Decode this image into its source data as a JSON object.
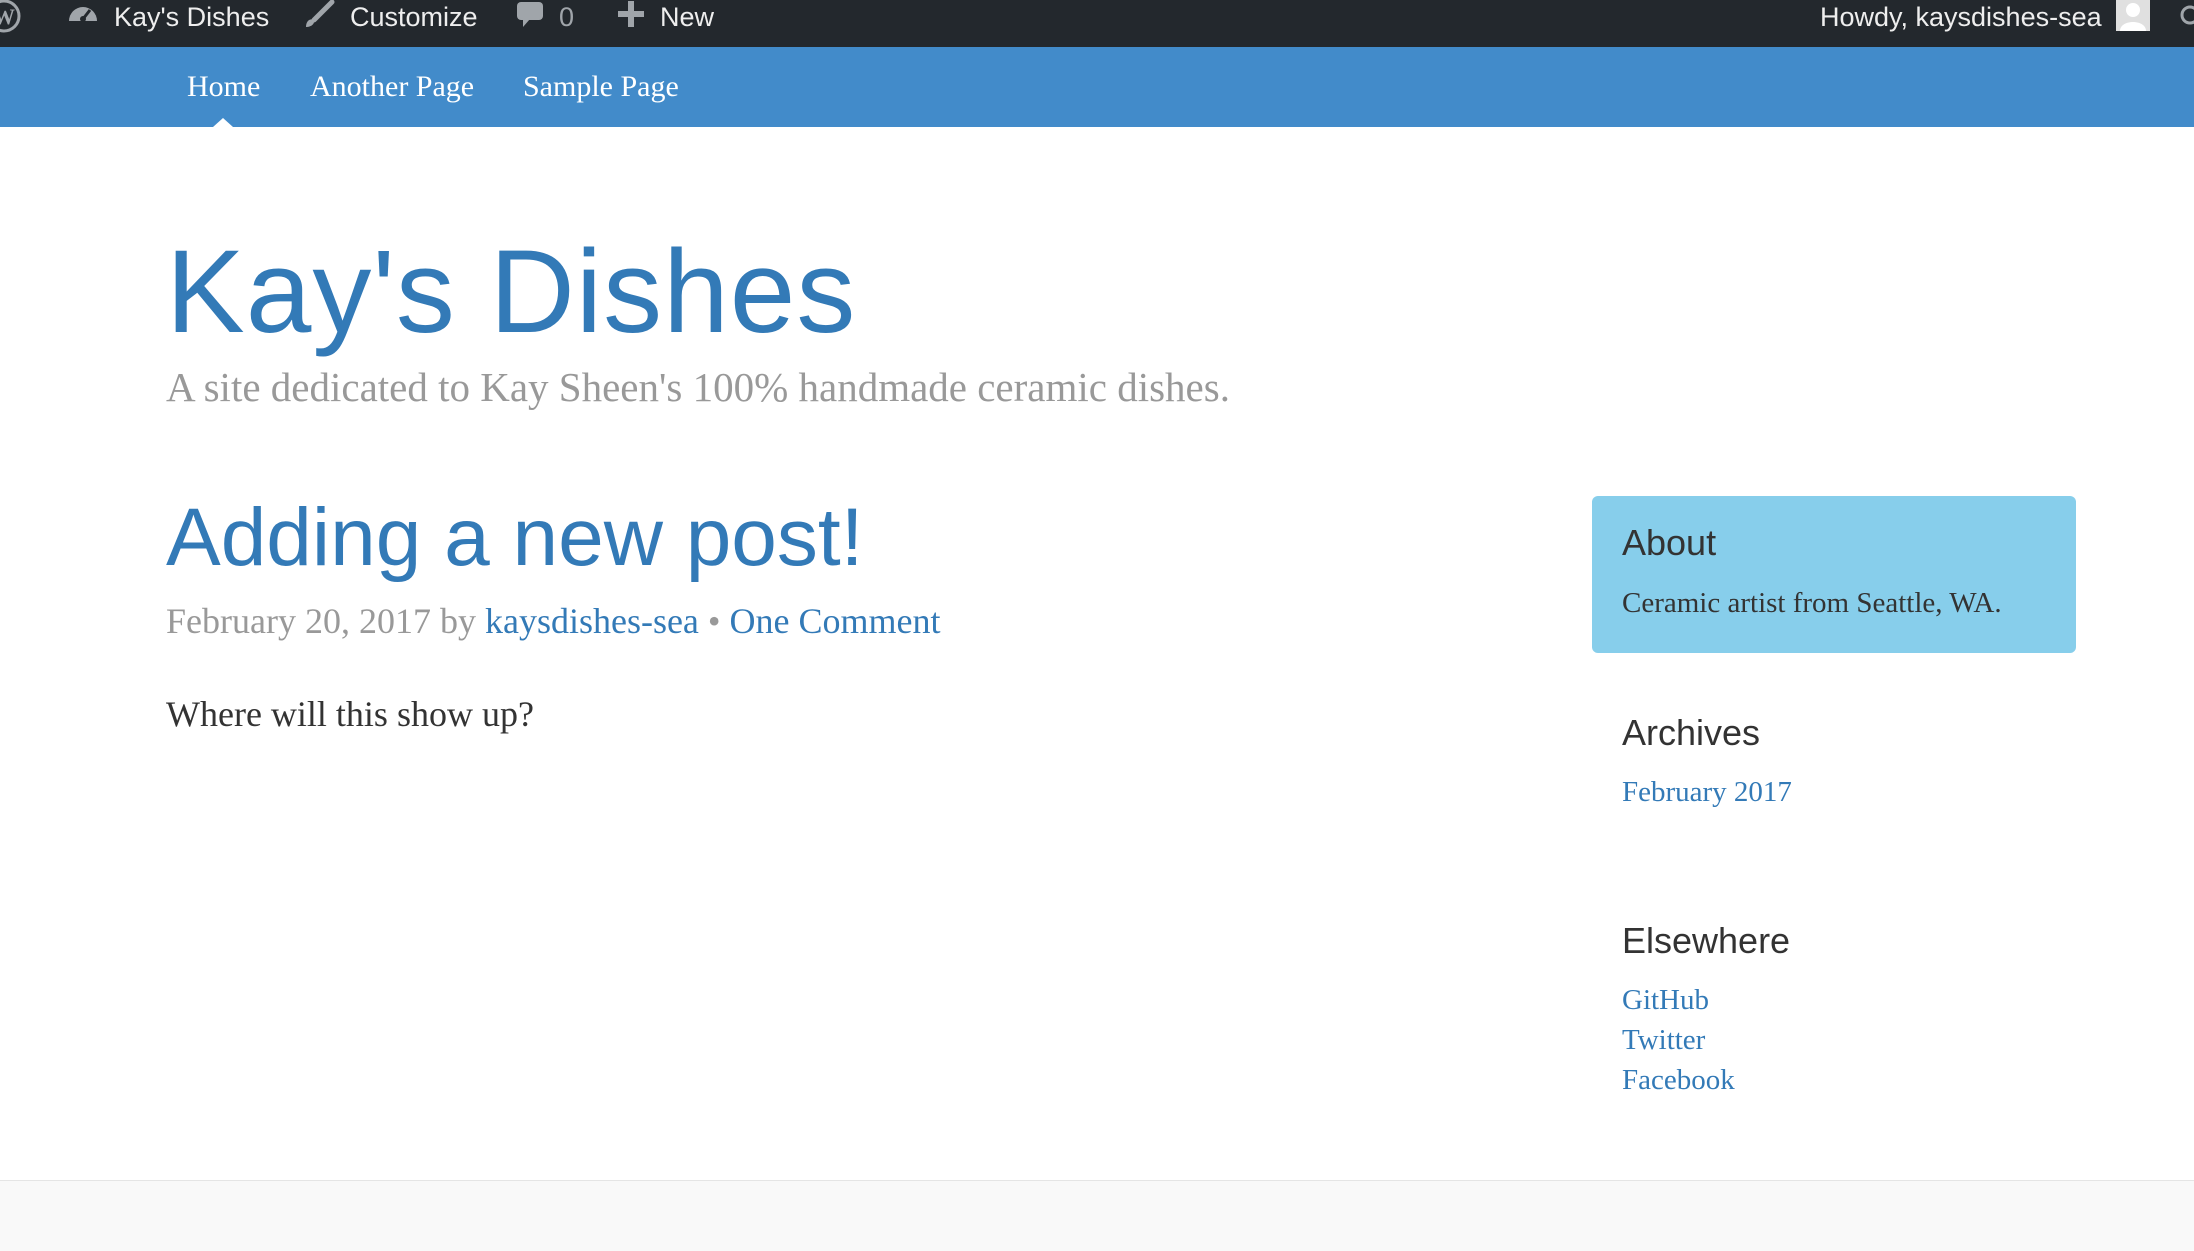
{
  "admin_bar": {
    "wp_icon": "wordpress-logo-icon",
    "site_name": "Kay's Dishes",
    "site_icon": "dashboard-icon",
    "customize": "Customize",
    "customize_icon": "paintbrush-icon",
    "comments_icon": "comment-bubble-icon",
    "comments_count": "0",
    "new_icon": "plus-icon",
    "new_label": "New",
    "howdy": "Howdy, kaysdishes-sea",
    "avatar_icon": "user-avatar-icon",
    "search_icon": "search-icon"
  },
  "nav": {
    "items": [
      {
        "label": "Home",
        "active": true
      },
      {
        "label": "Another Page",
        "active": false
      },
      {
        "label": "Sample Page",
        "active": false
      }
    ]
  },
  "header": {
    "title": "Kay's Dishes",
    "description": "A site dedicated to Kay Sheen's 100% handmade ceramic dishes."
  },
  "post": {
    "title": "Adding a new post!",
    "date": "February 20, 2017",
    "by": "by",
    "author": "kaysdishes-sea",
    "separator": "•",
    "comments": "One Comment",
    "body": "Where will this show up?"
  },
  "sidebar": {
    "about": {
      "title": "About",
      "text": "Ceramic artist from Seattle, WA."
    },
    "archives": {
      "title": "Archives",
      "items": [
        "February 2017"
      ]
    },
    "elsewhere": {
      "title": "Elsewhere",
      "links": [
        "GitHub",
        "Twitter",
        "Facebook"
      ]
    }
  },
  "colors": {
    "admin_bar": "#23282d",
    "nav_bar": "#428bca",
    "link": "#337ab7",
    "about_box": "#87ceeb",
    "muted": "#999999"
  }
}
